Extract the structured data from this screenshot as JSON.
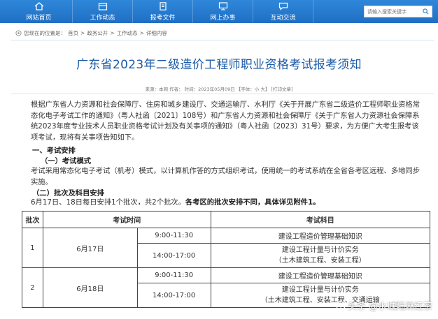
{
  "nav": {
    "items": [
      {
        "label": "网站首页",
        "icon": "home-icon"
      },
      {
        "label": "工作动态",
        "icon": "folder-icon"
      },
      {
        "label": "报考文件",
        "icon": "document-icon"
      },
      {
        "label": "网上办事",
        "icon": "monitor-icon"
      },
      {
        "label": "互动交流",
        "icon": "chat-icon"
      }
    ],
    "search_placeholder": "请输入搜索关键字"
  },
  "breadcrumb": {
    "prefix": "您现在的位置是：",
    "items": [
      "首页",
      "政务公开",
      "工作动态",
      "详细内容"
    ],
    "separator": ">"
  },
  "article": {
    "title": "广东省2023年二级造价工程师职业资格考试报考须知",
    "meta": "来源：本网   作者：   时间：2023年05月09日   【字体：小 大】   [打印文章]",
    "intro": "根据广东省人力资源和社会保障厅、住房和城乡建设厅、交通运输厅、水利厅《关于开展广东省二级造价工程师职业资格常态化电子考试工作的通知》（粤人社函〔2021〕108号）和广东省人力资源和社会保障厅《关于广东省人力资源社会保障系统2023年度专业技术人员职业资格考试计划及有关事项的通知》（粤人社函〔2023〕31号）要求，为方便广大考生报考该项考试，现将有关事项告知如下。",
    "h1": "一、考试安排",
    "h2": "（一）考试模式",
    "p2": "考试采用常态化电子考试（机考）模式，以计算机作答的方式组织考试，使用统一的考试系统在全省各考区远程、多地同步实施。",
    "h3": "（二）批次及科目安排",
    "p3_normal": "6月17日、18日每日安排1个批次，共2个批次。",
    "p3_bold": "各考区的批次安排不同，具体详见附件1。"
  },
  "table": {
    "headers": [
      "批次",
      "考试时间",
      "考试科目"
    ],
    "rows": [
      {
        "batch": "1",
        "date": "6月17日",
        "slots": [
          {
            "time": "9:00-11:30",
            "subject": "建设工程造价管理基础知识",
            "subject2": ""
          },
          {
            "time": "14:00-17:00",
            "subject": "建设工程计量与计价实务",
            "subject2": "（土木建筑工程、安装工程）"
          }
        ]
      },
      {
        "batch": "2",
        "date": "6月18日",
        "slots": [
          {
            "time": "9:00-11:30",
            "subject": "建设工程造价管理基础知识",
            "subject2": ""
          },
          {
            "time": "14:00-17:00",
            "subject": "建设工程计量与计价实务",
            "subject2": "（土木建筑工程、安装工程、交通运输"
          }
        ]
      }
    ]
  },
  "watermark": "头条 @水城陆淋红茶"
}
